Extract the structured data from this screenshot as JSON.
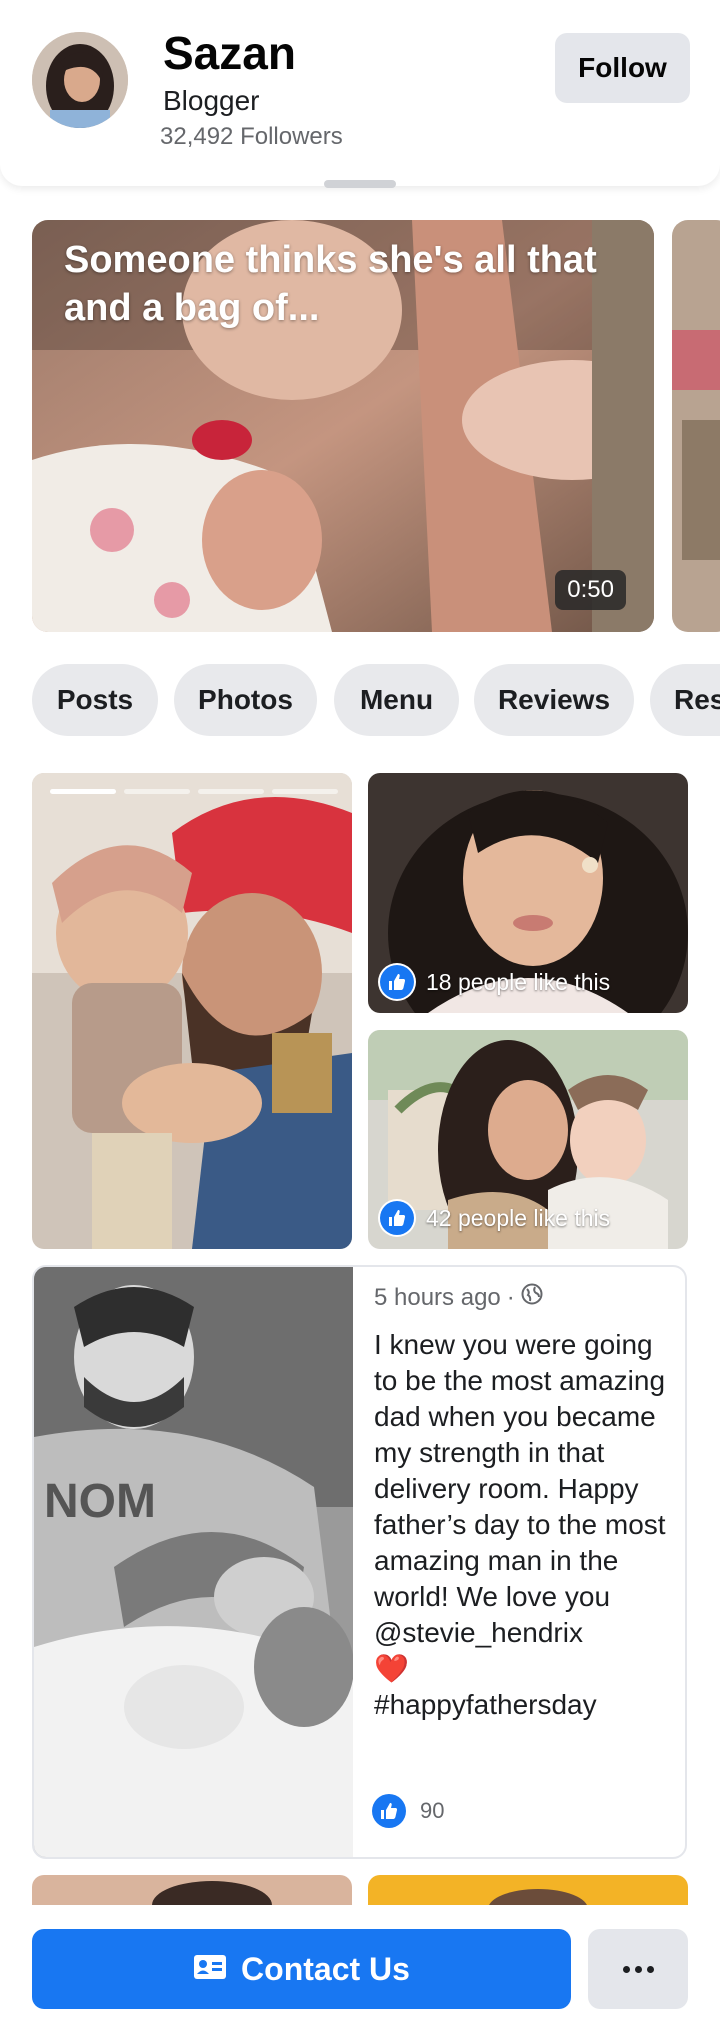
{
  "profile": {
    "name": "Sazan",
    "category": "Blogger",
    "followers": "32,492 Followers",
    "follow_label": "Follow"
  },
  "video": {
    "title": "Someone thinks she's all that and a bag of...",
    "duration": "0:50"
  },
  "tabs": [
    {
      "label": "Posts"
    },
    {
      "label": "Photos"
    },
    {
      "label": "Menu"
    },
    {
      "label": "Reviews"
    },
    {
      "label": "Res"
    }
  ],
  "grid": {
    "photo2_likes": "18 people like this",
    "photo3_likes": "42 people like this"
  },
  "post": {
    "time": "5 hours ago",
    "separator": "·",
    "text_main": "I knew you were going to be the most amazing dad when you became my strength in that delivery room. Happy father’s day to the most amazing man in the world! We love you @stevie_hendrix",
    "heart": "❤️",
    "hashtag": "#happyfathersday",
    "like_count": "90"
  },
  "actions": {
    "contact_label": "Contact Us",
    "more_label": "..."
  },
  "colors": {
    "accent": "#1877f2",
    "button_gray": "#e4e6eb",
    "secondary_text": "#65676b"
  }
}
